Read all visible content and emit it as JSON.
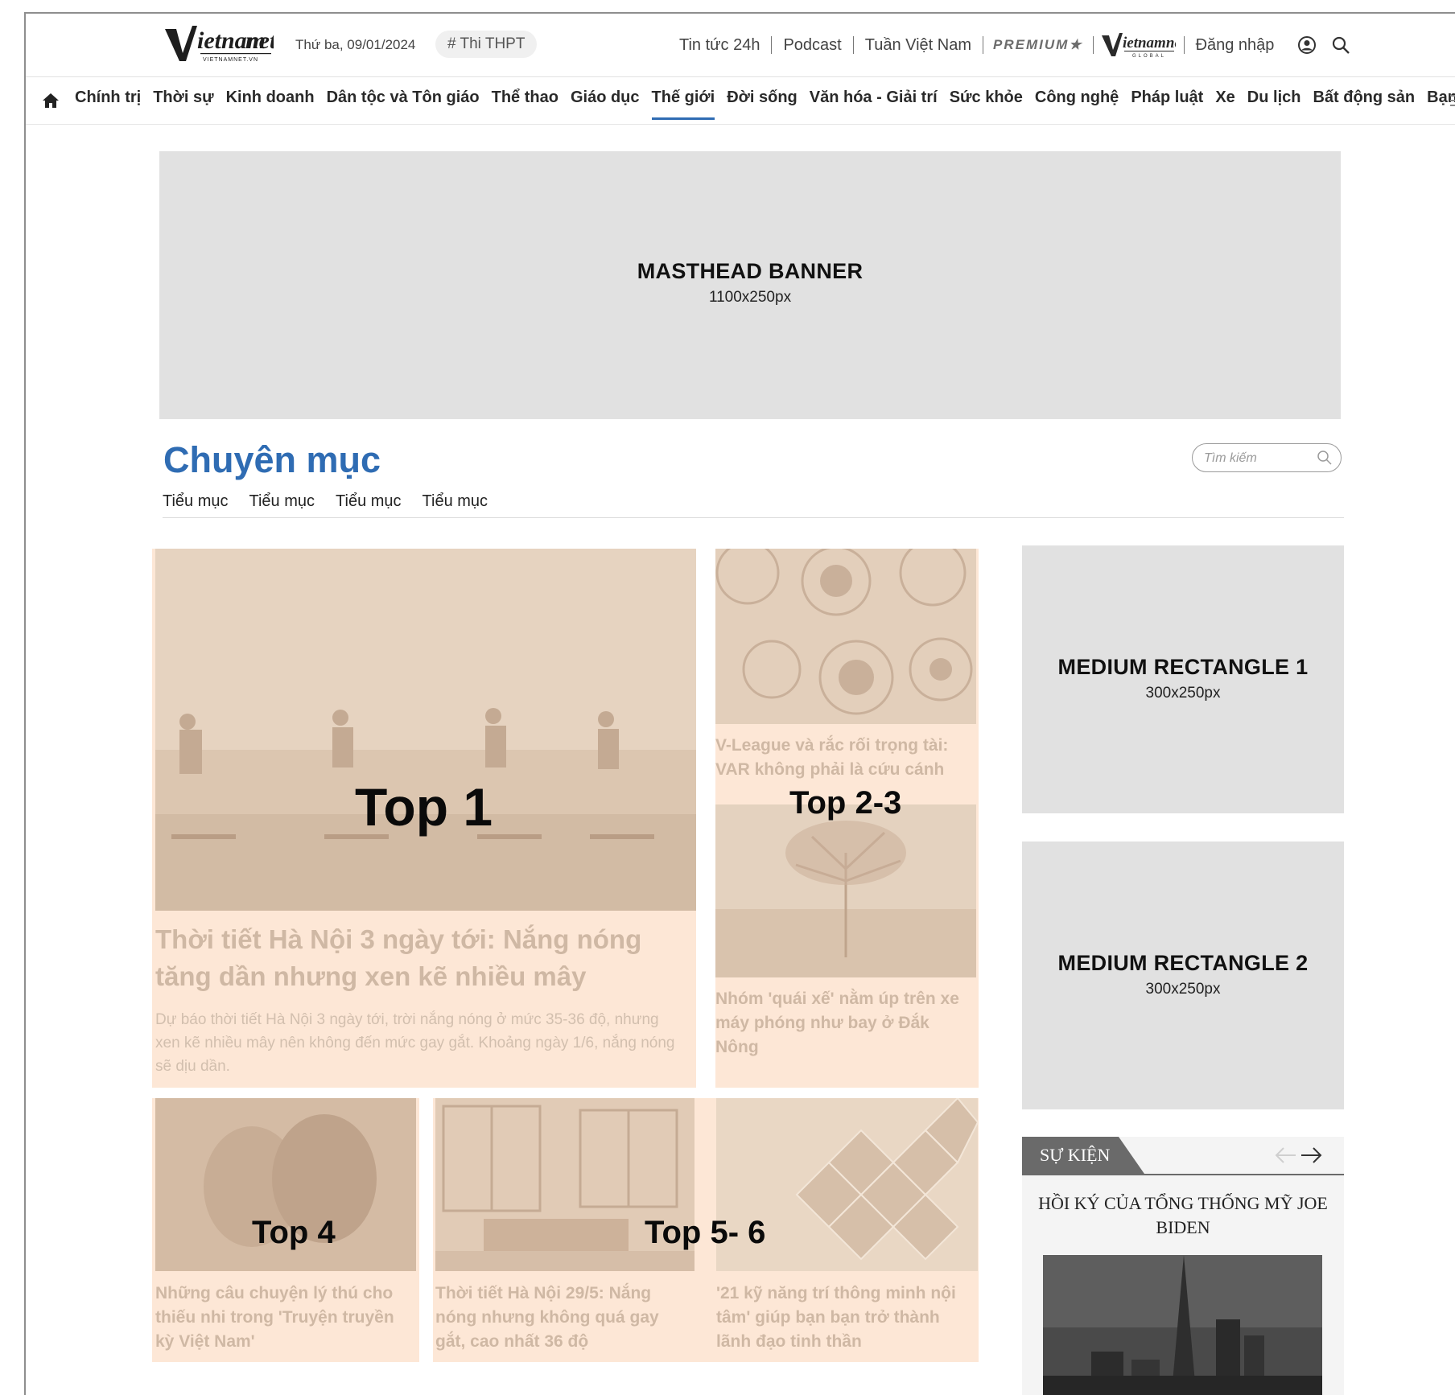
{
  "header": {
    "date": "Thứ ba, 09/01/2024",
    "tag": "# Thi THPT",
    "links": [
      "Tin tức 24h",
      "Podcast",
      "Tuần Việt Nam"
    ],
    "premium_label": "PREMIUM★",
    "login_label": "Đăng nhập"
  },
  "nav": {
    "categories": [
      {
        "label": "Chính trị"
      },
      {
        "label": "Thời sự"
      },
      {
        "label": "Kinh doanh"
      },
      {
        "label": "Dân tộc và Tôn giáo"
      },
      {
        "label": "Thể thao"
      },
      {
        "label": "Giáo dục"
      },
      {
        "label": "Thế giới",
        "active": true
      },
      {
        "label": "Đời sống"
      },
      {
        "label": "Văn hóa - Giải trí"
      },
      {
        "label": "Sức khỏe"
      },
      {
        "label": "Công nghệ"
      },
      {
        "label": "Pháp luật"
      },
      {
        "label": "Xe"
      },
      {
        "label": "Du lịch"
      },
      {
        "label": "Bất động sản"
      },
      {
        "label": "Bạn đọc"
      }
    ]
  },
  "masthead": {
    "title": "MASTHEAD BANNER",
    "size": "1100x250px"
  },
  "section": {
    "title": "Chuyên mục",
    "subcategories": [
      "Tiểu mục",
      "Tiểu mục",
      "Tiểu mục",
      "Tiểu mục"
    ],
    "search_placeholder": "Tìm kiếm"
  },
  "articles": {
    "top1": {
      "label": "Top 1",
      "headline": "Thời tiết Hà Nội 3 ngày tới: Nắng nóng tăng dần nhưng xen kẽ nhiều mây",
      "sapo": "Dự báo thời tiết Hà Nội 3 ngày tới, trời nắng nóng ở mức 35-36 độ, nhưng xen kẽ nhiều mây nên không đến mức gay gắt. Khoảng ngày 1/6, nắng nóng sẽ dịu dần."
    },
    "top23": {
      "label": "Top 2-3",
      "headline_a": "V-League và rắc rối trọng tài: VAR không phải là cứu cánh",
      "headline_b": "Nhóm 'quái xế' nằm úp trên xe máy phóng như bay ở Đắk Nông"
    },
    "top4": {
      "label": "Top 4",
      "headline": "Những câu chuyện lý thú cho thiếu nhi trong 'Truyện truyền kỳ Việt Nam'"
    },
    "top56": {
      "label": "Top 5- 6",
      "headline_a": "Thời tiết Hà Nội 29/5: Nắng nóng nhưng không quá gay gắt, cao nhất 36 độ",
      "headline_b": "'21 kỹ năng trí thông minh nội tâm' giúp bạn bạn trở thành lãnh đạo tinh thần"
    }
  },
  "sidebar": {
    "mrec1": {
      "title": "MEDIUM RECTANGLE 1",
      "size": "300x250px"
    },
    "mrec2": {
      "title": "MEDIUM RECTANGLE 2",
      "size": "300x250px"
    },
    "event": {
      "tab": "SỰ KIỆN",
      "title": "HỒI KÝ CỦA TỔNG THỐNG MỸ JOE BIDEN"
    }
  },
  "colors": {
    "accent": "#2f6cb3",
    "card_bg": "#fde7d6",
    "ad_bg": "#e1e1e1"
  }
}
